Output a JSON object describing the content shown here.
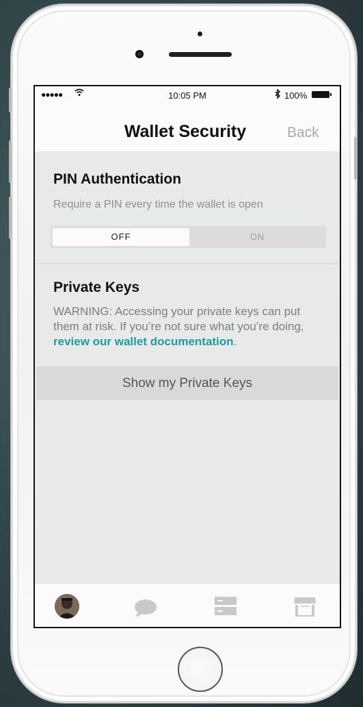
{
  "status_bar": {
    "signal": "●●●●●",
    "time": "10:05 PM",
    "bluetooth": "✱",
    "battery_percent": "100%",
    "battery_level": 1.0
  },
  "nav": {
    "title": "Wallet Security",
    "back_label": "Back"
  },
  "pin": {
    "title": "PIN Authentication",
    "description": "Require a PIN every time the wallet is open",
    "toggle": {
      "off_label": "OFF",
      "on_label": "ON",
      "selected": "OFF"
    }
  },
  "private_keys": {
    "title": "Private Keys",
    "warning_text": "WARNING: Accessing your private keys can put them at risk. If you’re not sure what you’re doing, ",
    "link_text": "review our wallet documentation",
    "warning_end": ".",
    "button_label": "Show my Private Keys"
  },
  "tabbar": {
    "tabs": [
      {
        "icon": "avatar"
      },
      {
        "icon": "chat-bubble-icon"
      },
      {
        "icon": "list-icon"
      },
      {
        "icon": "store-icon"
      }
    ]
  },
  "colors": {
    "accent_link": "#1d9ca1",
    "background": "#e9eaea",
    "nav_back": "#a9aaab"
  }
}
